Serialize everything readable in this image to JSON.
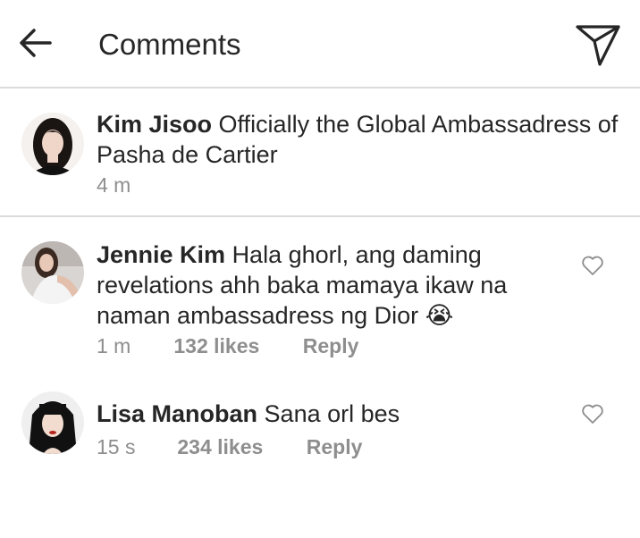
{
  "header": {
    "title": "Comments",
    "back_icon": "arrow-left-icon",
    "share_icon": "paper-plane-icon"
  },
  "caption": {
    "username": "Kim Jisoo",
    "text": "Officially the Global Ambassadress of Pasha de Cartier",
    "time": "4 m"
  },
  "comments": [
    {
      "username": "Jennie Kim",
      "text": "Hala ghorl, ang daming revelations ahh baka mamaya ikaw na naman ambassadress ng Dior",
      "emoji": "😭",
      "time": "1 m",
      "likes": "132 likes",
      "reply": "Reply"
    },
    {
      "username": "Lisa Manoban",
      "text": "Sana orl bes",
      "time": "15 s",
      "likes": "234 likes",
      "reply": "Reply"
    }
  ],
  "colors": {
    "text": "#262626",
    "muted": "#8e8e8e",
    "divider": "#dbdbdb"
  }
}
